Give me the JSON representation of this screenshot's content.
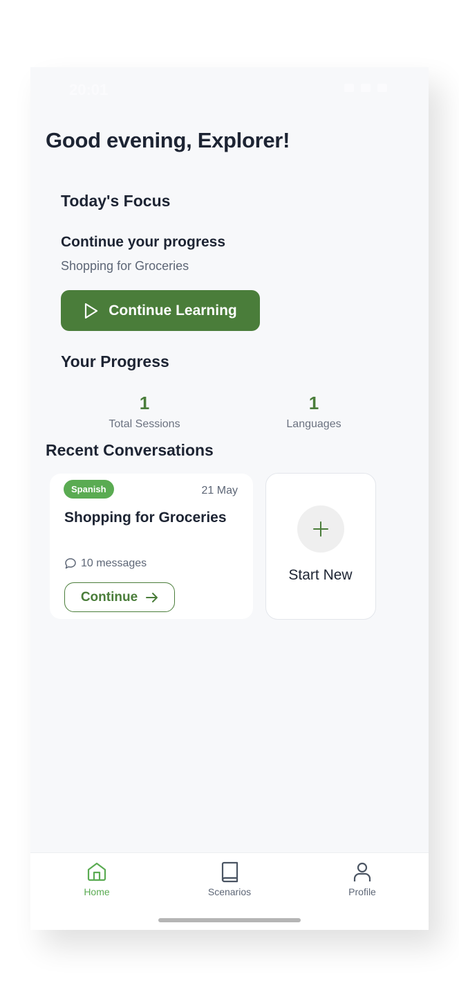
{
  "status_bar": {
    "time": "20:01"
  },
  "greeting": "Good evening, Explorer!",
  "focus": {
    "heading": "Today's Focus",
    "title": "Continue your progress",
    "subtitle": "Shopping for Groceries",
    "button_label": "Continue Learning"
  },
  "progress": {
    "heading": "Your Progress",
    "stats": [
      {
        "value": "1",
        "label": "Total Sessions"
      },
      {
        "value": "1",
        "label": "Languages"
      }
    ]
  },
  "recent": {
    "heading": "Recent Conversations",
    "conversations": [
      {
        "language": "Spanish",
        "date": "21 May",
        "title": "Shopping for Groceries",
        "messages": "10 messages",
        "button_label": "Continue"
      }
    ],
    "start_new_label": "Start New"
  },
  "tab_bar": {
    "items": [
      {
        "label": "Home",
        "icon": "home-icon",
        "active": true
      },
      {
        "label": "Scenarios",
        "icon": "book-icon",
        "active": false
      },
      {
        "label": "Profile",
        "icon": "user-icon",
        "active": false
      }
    ]
  },
  "colors": {
    "primary": "#4a7d3a",
    "badge": "#5aab52",
    "text": "#1d2433",
    "muted": "#5d6676",
    "background": "#f7f8fa"
  }
}
